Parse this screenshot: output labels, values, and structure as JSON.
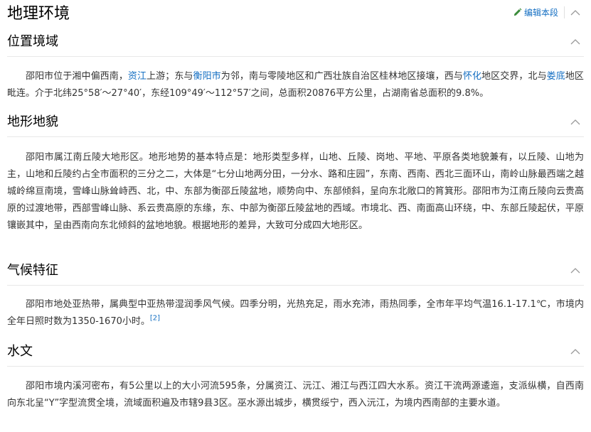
{
  "heading": {
    "title": "地理环境",
    "edit_label": "编辑本段",
    "icons": {
      "edit": "pencil-icon",
      "collapse": "chevron-up-icon"
    }
  },
  "accent_color": "#136ec2",
  "sections": [
    {
      "title": "位置境域",
      "segments": [
        {
          "text": "邵阳市位于湘中偏西南，"
        },
        {
          "text": "资江",
          "link": true
        },
        {
          "text": "上游；东与"
        },
        {
          "text": "衡阳市",
          "link": true
        },
        {
          "text": "为邻，南与零陵地区和广西壮族自治区桂林地区接壤，西与"
        },
        {
          "text": "怀化",
          "link": true
        },
        {
          "text": "地区交界，北与"
        },
        {
          "text": "娄底",
          "link": true
        },
        {
          "text": "地区毗连。介于北纬25°58′～27°40′，东经109°49′～112°57′之间，总面积20876平方公里，占湖南省总面积的9.8%。"
        }
      ]
    },
    {
      "title": "地形地貌",
      "segments": [
        {
          "text": "邵阳市属江南丘陵大地形区。地形地势的基本特点是：地形类型多样，山地、丘陵、岗地、平地、平原各类地貌兼有，以丘陵、山地为主，山地和丘陵约占全市面积的三分之二，大体是“七分山地两分田，一分水、路和庄园”，东南、西南、西北三面环山，南岭山脉最西端之越城岭绵亘南境，雪峰山脉耸峙西、北，中、东部为衡邵丘陵盆地，顺势向中、东部倾斜，呈向东北敞口的筲箕形。邵阳市为江南丘陵向云贵高原的过渡地带，西部雪峰山脉、系云贵高原的东缘，东、中部为衡邵丘陵盆地的西域。市境北、西、南面高山环绕，中、东部丘陵起伏，平原镶嵌其中，呈由西南向东北倾斜的盆地地貌。根据地形的差异，大致可分成四大地形区。"
        }
      ]
    },
    {
      "title": "气候特征",
      "segments": [
        {
          "text": "邵阳市地处亚热带，属典型中亚热带湿润季风气候。四季分明，光热充足，雨水充沛，雨热同季，全市年平均气温16.1-17.1℃，市境内全年日照时数为1350-1670小时。"
        },
        {
          "text": "[2]",
          "sup": true
        }
      ]
    },
    {
      "title": "水文",
      "segments": [
        {
          "text": "邵阳市境内溪河密布，有5公里以上的大小河流595条，分属资江、沅江、湘江与西江四大水系。资江干流两源逶迤，支派纵横，自西南向东北呈“Y”字型流贯全境，流域面积遍及市辖9县3区。巫水源出城步，横贯绥宁，西入沅江，为境内西南部的主要水道。"
        }
      ]
    }
  ]
}
